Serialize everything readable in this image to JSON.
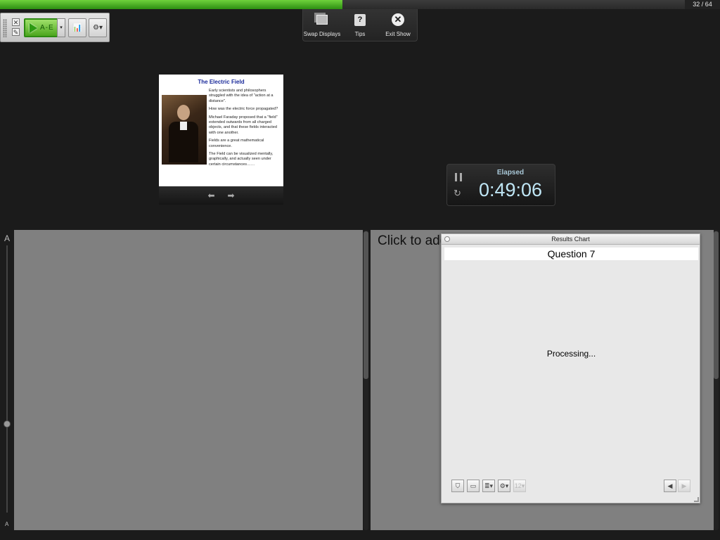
{
  "progress": {
    "fraction": 0.5,
    "counter": "32 / 64"
  },
  "toolbar": {
    "start_label": "A-E",
    "dropdown_glyph": "▾",
    "results_glyph": "📊",
    "settings_glyph": "⚙▾",
    "mini_close_glyph": "✕",
    "mini_edit_glyph": "✎"
  },
  "presenter_menu": {
    "items": [
      {
        "label": "Swap Displays",
        "icon": "swap-displays-icon"
      },
      {
        "label": "Tips",
        "icon": "tips-icon",
        "glyph": "?"
      },
      {
        "label": "Exit Show",
        "icon": "exit-icon",
        "glyph": "✕"
      }
    ]
  },
  "slide": {
    "title": "The Electric Field",
    "paragraphs": [
      "Early scientists and philosophers struggled with the idea of \"action at a distance\".",
      "How was the electric force propagated?",
      "Michael Faraday proposed that a \"field\" extended outwards from all charged objects, and that these fields interacted with one another.",
      "Fields are a great mathematical convenience.",
      "The Field can be visualized mentally, graphically, and actually seen under certain circumstances……"
    ],
    "prev_glyph": "⬅",
    "next_glyph": "➡"
  },
  "timer": {
    "label": "Elapsed",
    "value": "0:49:06",
    "reset_glyph": "↻"
  },
  "zoom": {
    "large_label": "A",
    "small_label": "A"
  },
  "notes": {
    "prompt": "Click to add"
  },
  "results_chart": {
    "window_title": "Results Chart",
    "question": "Question 7",
    "status": "Processing...",
    "tools": [
      "⛉",
      "▭",
      "≣▾",
      "⚙▾",
      "12▾"
    ],
    "prev_glyph": "◀",
    "next_glyph": "▶"
  }
}
